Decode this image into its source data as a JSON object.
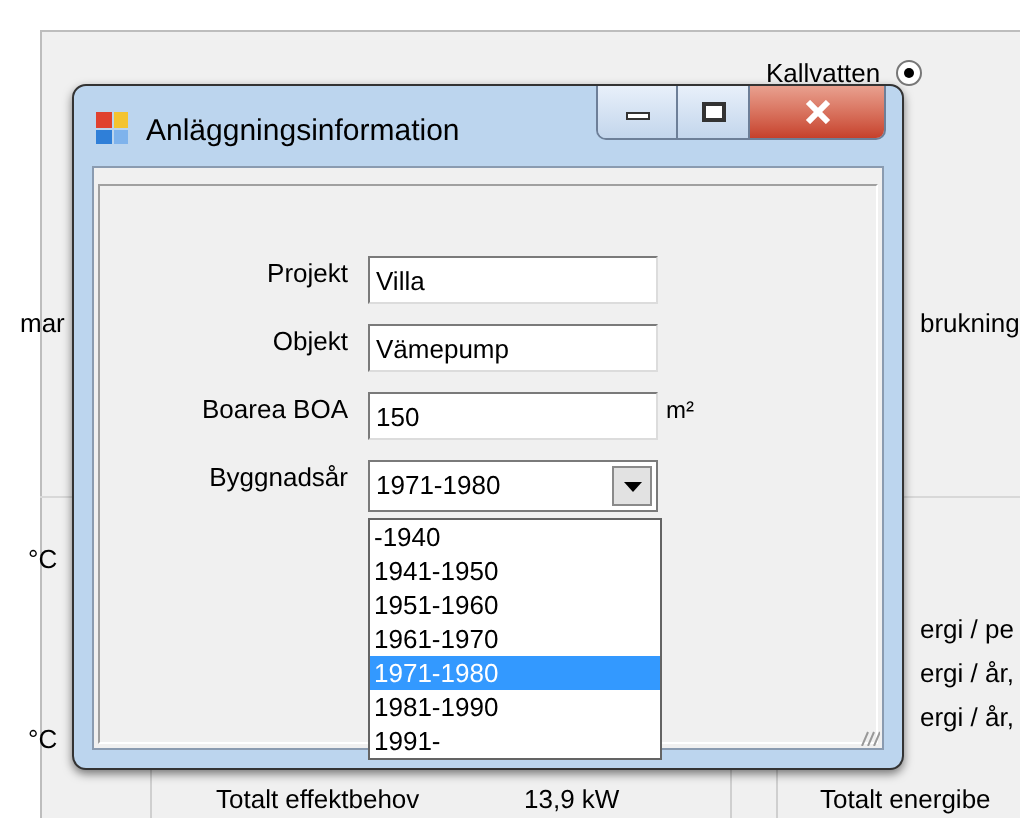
{
  "background": {
    "radio": {
      "label": "Kallvatten",
      "checked": true
    },
    "left_labels": [
      "mar",
      "°C",
      "°C"
    ],
    "right_labels": [
      "brukning",
      "ergi / pe",
      "ergi / år,",
      "ergi / år,"
    ],
    "footer": {
      "effect_label": "Totalt effektbehov",
      "effect_value": "13,9 kW",
      "energy_label": "Totalt energibe"
    }
  },
  "dialog": {
    "title": "Anläggningsinformation",
    "fields": [
      {
        "label": "Projekt",
        "value": "Villa"
      },
      {
        "label": "Objekt",
        "value": "Vämepump"
      },
      {
        "label": "Boarea BOA",
        "value": "150",
        "unit": "m²"
      }
    ],
    "year": {
      "label": "Byggnadsår",
      "value": "1971-1980",
      "expanded": true,
      "options": [
        {
          "label": "-1940",
          "selected": false
        },
        {
          "label": "1941-1950",
          "selected": false
        },
        {
          "label": "1951-1960",
          "selected": false
        },
        {
          "label": "1961-1970",
          "selected": false
        },
        {
          "label": "1971-1980",
          "selected": true
        },
        {
          "label": "1981-1990",
          "selected": false
        },
        {
          "label": "1991-",
          "selected": false
        }
      ]
    }
  }
}
